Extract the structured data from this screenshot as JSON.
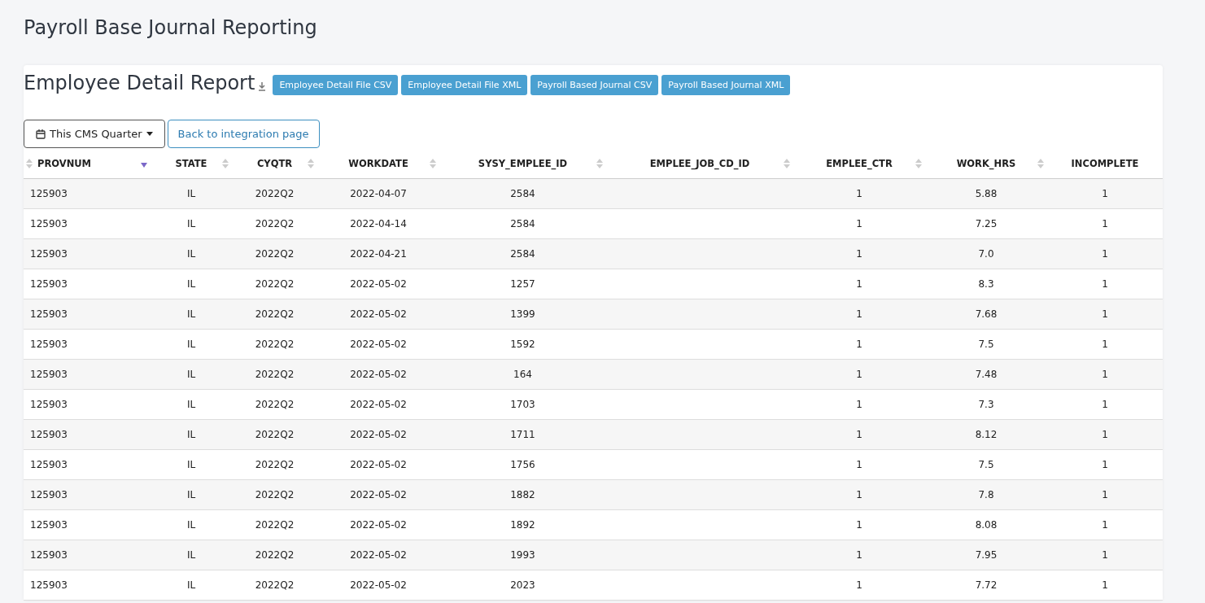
{
  "page_title": "Payroll Base Journal Reporting",
  "report": {
    "title": "Employee Detail Report",
    "export_buttons": [
      "Employee Detail File CSV",
      "Employee Detail File XML",
      "Payroll Based Journal CSV",
      "Payroll Based Journal XML"
    ],
    "period_dropdown": "This CMS Quarter",
    "back_button": "Back to integration page"
  },
  "table": {
    "columns": [
      {
        "label": "PROVNUM",
        "sorted": true
      },
      {
        "label": "STATE",
        "sorted": false
      },
      {
        "label": "CYQTR",
        "sorted": false
      },
      {
        "label": "WORKDATE",
        "sorted": false
      },
      {
        "label": "SYSY_EMPLEE_ID",
        "sorted": false
      },
      {
        "label": "EMPLEE_JOB_CD_ID",
        "sorted": false
      },
      {
        "label": "EMPLEE_CTR",
        "sorted": false
      },
      {
        "label": "WORK_HRS",
        "sorted": false
      },
      {
        "label": "INCOMPLETE"
      }
    ],
    "rows": [
      [
        "125903",
        "IL",
        "2022Q2",
        "2022-04-07",
        "2584",
        "",
        "1",
        "5.88",
        "1"
      ],
      [
        "125903",
        "IL",
        "2022Q2",
        "2022-04-14",
        "2584",
        "",
        "1",
        "7.25",
        "1"
      ],
      [
        "125903",
        "IL",
        "2022Q2",
        "2022-04-21",
        "2584",
        "",
        "1",
        "7.0",
        "1"
      ],
      [
        "125903",
        "IL",
        "2022Q2",
        "2022-05-02",
        "1257",
        "",
        "1",
        "8.3",
        "1"
      ],
      [
        "125903",
        "IL",
        "2022Q2",
        "2022-05-02",
        "1399",
        "",
        "1",
        "7.68",
        "1"
      ],
      [
        "125903",
        "IL",
        "2022Q2",
        "2022-05-02",
        "1592",
        "",
        "1",
        "7.5",
        "1"
      ],
      [
        "125903",
        "IL",
        "2022Q2",
        "2022-05-02",
        "164",
        "",
        "1",
        "7.48",
        "1"
      ],
      [
        "125903",
        "IL",
        "2022Q2",
        "2022-05-02",
        "1703",
        "",
        "1",
        "7.3",
        "1"
      ],
      [
        "125903",
        "IL",
        "2022Q2",
        "2022-05-02",
        "1711",
        "",
        "1",
        "8.12",
        "1"
      ],
      [
        "125903",
        "IL",
        "2022Q2",
        "2022-05-02",
        "1756",
        "",
        "1",
        "7.5",
        "1"
      ],
      [
        "125903",
        "IL",
        "2022Q2",
        "2022-05-02",
        "1882",
        "",
        "1",
        "7.8",
        "1"
      ],
      [
        "125903",
        "IL",
        "2022Q2",
        "2022-05-02",
        "1892",
        "",
        "1",
        "8.08",
        "1"
      ],
      [
        "125903",
        "IL",
        "2022Q2",
        "2022-05-02",
        "1993",
        "",
        "1",
        "7.95",
        "1"
      ],
      [
        "125903",
        "IL",
        "2022Q2",
        "2022-05-02",
        "2023",
        "",
        "1",
        "7.72",
        "1"
      ]
    ]
  }
}
